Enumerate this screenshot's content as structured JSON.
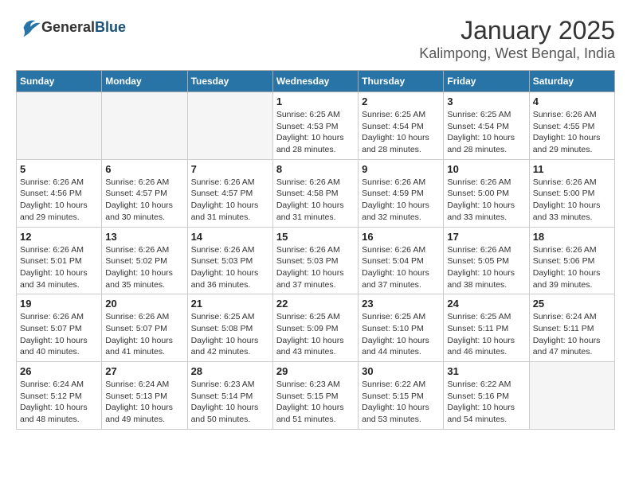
{
  "header": {
    "logo_general": "General",
    "logo_blue": "Blue",
    "title": "January 2025",
    "subtitle": "Kalimpong, West Bengal, India"
  },
  "days_of_week": [
    "Sunday",
    "Monday",
    "Tuesday",
    "Wednesday",
    "Thursday",
    "Friday",
    "Saturday"
  ],
  "weeks": [
    [
      {
        "day": "",
        "sunrise": "",
        "sunset": "",
        "daylight": "",
        "empty": true
      },
      {
        "day": "",
        "sunrise": "",
        "sunset": "",
        "daylight": "",
        "empty": true
      },
      {
        "day": "",
        "sunrise": "",
        "sunset": "",
        "daylight": "",
        "empty": true
      },
      {
        "day": "1",
        "sunrise": "Sunrise: 6:25 AM",
        "sunset": "Sunset: 4:53 PM",
        "daylight": "Daylight: 10 hours and 28 minutes."
      },
      {
        "day": "2",
        "sunrise": "Sunrise: 6:25 AM",
        "sunset": "Sunset: 4:54 PM",
        "daylight": "Daylight: 10 hours and 28 minutes."
      },
      {
        "day": "3",
        "sunrise": "Sunrise: 6:25 AM",
        "sunset": "Sunset: 4:54 PM",
        "daylight": "Daylight: 10 hours and 28 minutes."
      },
      {
        "day": "4",
        "sunrise": "Sunrise: 6:26 AM",
        "sunset": "Sunset: 4:55 PM",
        "daylight": "Daylight: 10 hours and 29 minutes."
      }
    ],
    [
      {
        "day": "5",
        "sunrise": "Sunrise: 6:26 AM",
        "sunset": "Sunset: 4:56 PM",
        "daylight": "Daylight: 10 hours and 29 minutes."
      },
      {
        "day": "6",
        "sunrise": "Sunrise: 6:26 AM",
        "sunset": "Sunset: 4:57 PM",
        "daylight": "Daylight: 10 hours and 30 minutes."
      },
      {
        "day": "7",
        "sunrise": "Sunrise: 6:26 AM",
        "sunset": "Sunset: 4:57 PM",
        "daylight": "Daylight: 10 hours and 31 minutes."
      },
      {
        "day": "8",
        "sunrise": "Sunrise: 6:26 AM",
        "sunset": "Sunset: 4:58 PM",
        "daylight": "Daylight: 10 hours and 31 minutes."
      },
      {
        "day": "9",
        "sunrise": "Sunrise: 6:26 AM",
        "sunset": "Sunset: 4:59 PM",
        "daylight": "Daylight: 10 hours and 32 minutes."
      },
      {
        "day": "10",
        "sunrise": "Sunrise: 6:26 AM",
        "sunset": "Sunset: 5:00 PM",
        "daylight": "Daylight: 10 hours and 33 minutes."
      },
      {
        "day": "11",
        "sunrise": "Sunrise: 6:26 AM",
        "sunset": "Sunset: 5:00 PM",
        "daylight": "Daylight: 10 hours and 33 minutes."
      }
    ],
    [
      {
        "day": "12",
        "sunrise": "Sunrise: 6:26 AM",
        "sunset": "Sunset: 5:01 PM",
        "daylight": "Daylight: 10 hours and 34 minutes."
      },
      {
        "day": "13",
        "sunrise": "Sunrise: 6:26 AM",
        "sunset": "Sunset: 5:02 PM",
        "daylight": "Daylight: 10 hours and 35 minutes."
      },
      {
        "day": "14",
        "sunrise": "Sunrise: 6:26 AM",
        "sunset": "Sunset: 5:03 PM",
        "daylight": "Daylight: 10 hours and 36 minutes."
      },
      {
        "day": "15",
        "sunrise": "Sunrise: 6:26 AM",
        "sunset": "Sunset: 5:03 PM",
        "daylight": "Daylight: 10 hours and 37 minutes."
      },
      {
        "day": "16",
        "sunrise": "Sunrise: 6:26 AM",
        "sunset": "Sunset: 5:04 PM",
        "daylight": "Daylight: 10 hours and 37 minutes."
      },
      {
        "day": "17",
        "sunrise": "Sunrise: 6:26 AM",
        "sunset": "Sunset: 5:05 PM",
        "daylight": "Daylight: 10 hours and 38 minutes."
      },
      {
        "day": "18",
        "sunrise": "Sunrise: 6:26 AM",
        "sunset": "Sunset: 5:06 PM",
        "daylight": "Daylight: 10 hours and 39 minutes."
      }
    ],
    [
      {
        "day": "19",
        "sunrise": "Sunrise: 6:26 AM",
        "sunset": "Sunset: 5:07 PM",
        "daylight": "Daylight: 10 hours and 40 minutes."
      },
      {
        "day": "20",
        "sunrise": "Sunrise: 6:26 AM",
        "sunset": "Sunset: 5:07 PM",
        "daylight": "Daylight: 10 hours and 41 minutes."
      },
      {
        "day": "21",
        "sunrise": "Sunrise: 6:25 AM",
        "sunset": "Sunset: 5:08 PM",
        "daylight": "Daylight: 10 hours and 42 minutes."
      },
      {
        "day": "22",
        "sunrise": "Sunrise: 6:25 AM",
        "sunset": "Sunset: 5:09 PM",
        "daylight": "Daylight: 10 hours and 43 minutes."
      },
      {
        "day": "23",
        "sunrise": "Sunrise: 6:25 AM",
        "sunset": "Sunset: 5:10 PM",
        "daylight": "Daylight: 10 hours and 44 minutes."
      },
      {
        "day": "24",
        "sunrise": "Sunrise: 6:25 AM",
        "sunset": "Sunset: 5:11 PM",
        "daylight": "Daylight: 10 hours and 46 minutes."
      },
      {
        "day": "25",
        "sunrise": "Sunrise: 6:24 AM",
        "sunset": "Sunset: 5:11 PM",
        "daylight": "Daylight: 10 hours and 47 minutes."
      }
    ],
    [
      {
        "day": "26",
        "sunrise": "Sunrise: 6:24 AM",
        "sunset": "Sunset: 5:12 PM",
        "daylight": "Daylight: 10 hours and 48 minutes."
      },
      {
        "day": "27",
        "sunrise": "Sunrise: 6:24 AM",
        "sunset": "Sunset: 5:13 PM",
        "daylight": "Daylight: 10 hours and 49 minutes."
      },
      {
        "day": "28",
        "sunrise": "Sunrise: 6:23 AM",
        "sunset": "Sunset: 5:14 PM",
        "daylight": "Daylight: 10 hours and 50 minutes."
      },
      {
        "day": "29",
        "sunrise": "Sunrise: 6:23 AM",
        "sunset": "Sunset: 5:15 PM",
        "daylight": "Daylight: 10 hours and 51 minutes."
      },
      {
        "day": "30",
        "sunrise": "Sunrise: 6:22 AM",
        "sunset": "Sunset: 5:15 PM",
        "daylight": "Daylight: 10 hours and 53 minutes."
      },
      {
        "day": "31",
        "sunrise": "Sunrise: 6:22 AM",
        "sunset": "Sunset: 5:16 PM",
        "daylight": "Daylight: 10 hours and 54 minutes."
      },
      {
        "day": "",
        "sunrise": "",
        "sunset": "",
        "daylight": "",
        "empty": true
      }
    ]
  ]
}
